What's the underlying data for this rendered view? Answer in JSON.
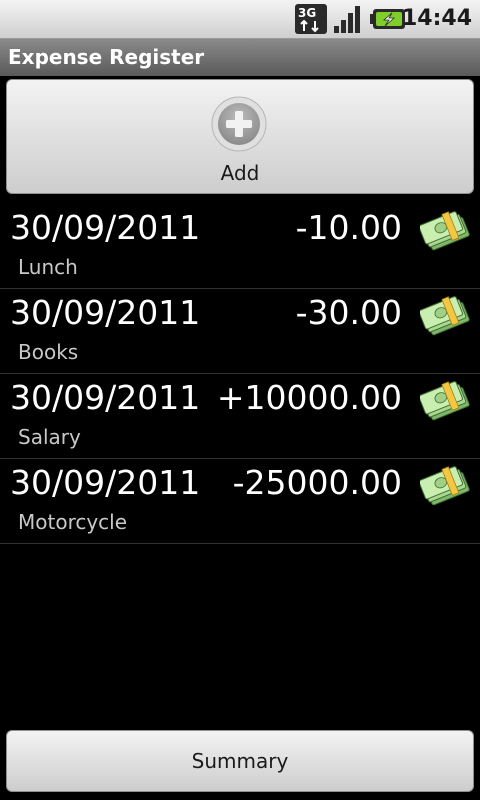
{
  "status_bar": {
    "network_label": "3G",
    "time": "14:44",
    "icons": [
      "network-3g-icon",
      "signal-strength-icon",
      "battery-charging-icon"
    ]
  },
  "app": {
    "title": "Expense Register"
  },
  "add_button": {
    "label": "Add",
    "icon": "plus-circle-icon"
  },
  "expenses": [
    {
      "date": "30/09/2011",
      "amount": "-10.00",
      "description": "Lunch",
      "icon": "money-stack-icon"
    },
    {
      "date": "30/09/2011",
      "amount": "-30.00",
      "description": "Books",
      "icon": "money-stack-icon"
    },
    {
      "date": "30/09/2011",
      "amount": "+10000.00",
      "description": "Salary",
      "icon": "money-stack-icon"
    },
    {
      "date": "30/09/2011",
      "amount": "-25000.00",
      "description": "Motorcycle",
      "icon": "money-stack-icon"
    }
  ],
  "summary_button": {
    "label": "Summary"
  }
}
